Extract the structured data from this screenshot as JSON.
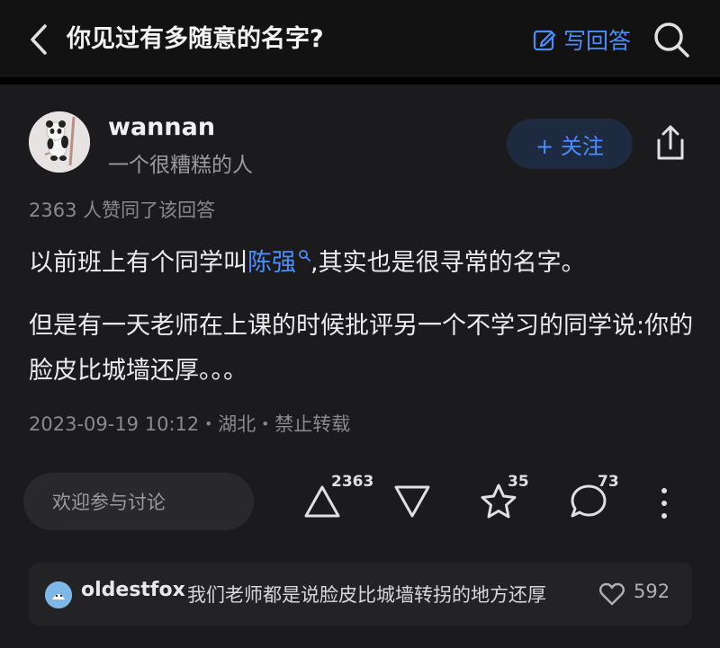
{
  "header": {
    "title": "你见过有多随意的名字?",
    "write_label": "写回答"
  },
  "author": {
    "name": "wannan",
    "bio": "一个很糟糕的人"
  },
  "follow_label": "+ 关注",
  "answer": {
    "upvote_summary": "2363 人赞同了该回答",
    "p1_before": "以前班上有个同学叫",
    "p1_link": "陈强",
    "p1_after": ",其实也是很寻常的名字。",
    "p2": "但是有一天老师在上课的时候批评另一个不学习的同学说:你的脸皮比城墙还厚。。。",
    "meta": "2023-09-19 10:12・湖北・禁止转载"
  },
  "actions": {
    "comment_placeholder": "欢迎参与讨论",
    "upvotes": "2363",
    "stars": "35",
    "comments": "73"
  },
  "top_comment": {
    "user": "oldestfox",
    "text": "我们老师都是说脸皮比城墙转拐的地方还厚",
    "likes": "592"
  },
  "colors": {
    "accent": "#4a8dff",
    "background": "#1b1b1d"
  }
}
